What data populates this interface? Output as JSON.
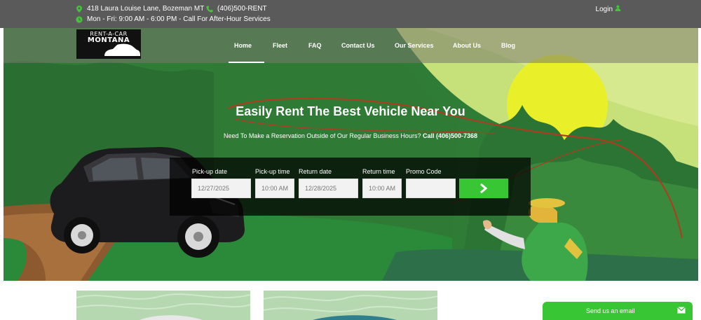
{
  "topbar": {
    "address": "418 Laura Louise Lane, Bozeman MT",
    "phone": "(406)500-RENT",
    "hours": "Mon - Fri: 9:00 AM - 6:00 PM - Call For After-Hour Services",
    "login": "Login"
  },
  "logo": {
    "line1": "RENT-A-CAR",
    "line2": "MONTANA"
  },
  "nav": {
    "items": [
      {
        "label": "Home"
      },
      {
        "label": "Fleet"
      },
      {
        "label": "FAQ"
      },
      {
        "label": "Contact Us"
      },
      {
        "label": "Our Services"
      },
      {
        "label": "About Us"
      },
      {
        "label": "Blog"
      }
    ],
    "active": "Home"
  },
  "hero": {
    "headline": "Easily Rent The Best Vehicle Near You",
    "subline_text": "Need To Make a Reservation Outside of Our Regular Business Hours?",
    "subline_call": "Call (406)500-7368"
  },
  "booking": {
    "pickup_date_label": "Pick-up date",
    "pickup_date_value": "12/27/2025",
    "pickup_time_label": "Pick-up time",
    "pickup_time_value": "10:00 AM",
    "return_date_label": "Return date",
    "return_date_value": "12/28/2025",
    "return_time_label": "Return time",
    "return_time_value": "10:00 AM",
    "promo_label": "Promo Code",
    "promo_value": "",
    "submit_icon": "chevron-right-icon"
  },
  "mail_widget": {
    "label": "Send us an email",
    "icon": "envelope-icon"
  },
  "colors": {
    "accent_green": "#38c635",
    "topbar_bg": "#5a5a5a"
  }
}
